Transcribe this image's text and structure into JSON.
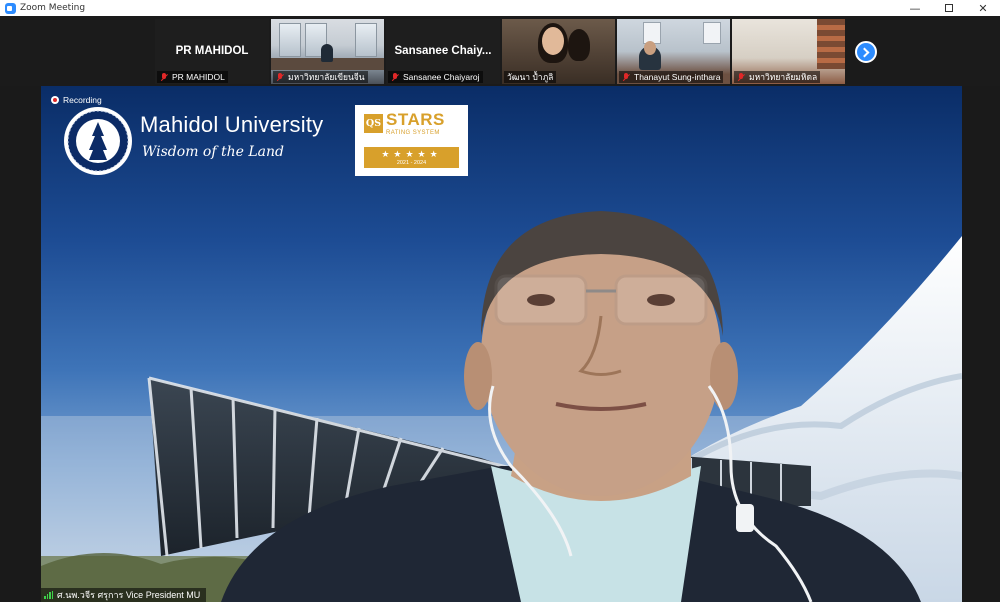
{
  "window": {
    "title": "Zoom Meeting",
    "minimize_glyph": "—",
    "close_glyph": "✕"
  },
  "gallery": {
    "participants": [
      {
        "name": "PR MAHIDOL",
        "video": false,
        "display_name": "PR MAHIDOL",
        "muted": true
      },
      {
        "name": "มหาวิทยาลัยเขียนจีน",
        "video": true,
        "muted": true
      },
      {
        "name": "Sansanee Chaiyaroj",
        "video": false,
        "display_name": "Sansanee  Chaiy...",
        "muted": true
      },
      {
        "name": "วัฒนา ป้ำภูลิ",
        "video": true,
        "muted": false
      },
      {
        "name": "Thanayut Sung-inthara",
        "video": true,
        "muted": true
      },
      {
        "name": "มหาวิทยาลัยมหิดล",
        "video": true,
        "muted": true
      }
    ],
    "next_page_icon": "chevron-right-icon"
  },
  "main_video": {
    "recording_label": "Recording",
    "speaker_name": "ศ.นพ.วจีร ศรุการ Vice President MU",
    "background": {
      "university_name": "Mahidol University",
      "tagline": "Wisdom of the Land",
      "qs_badge": {
        "mark": "QS",
        "title": "STARS",
        "subtitle": "RATING SYSTEM",
        "rating": "★★★★★",
        "years": "2021 - 2024"
      }
    }
  },
  "colors": {
    "zoom_blue": "#2d8cff",
    "muted_red": "#e02828",
    "qs_gold": "#d8a02b"
  }
}
